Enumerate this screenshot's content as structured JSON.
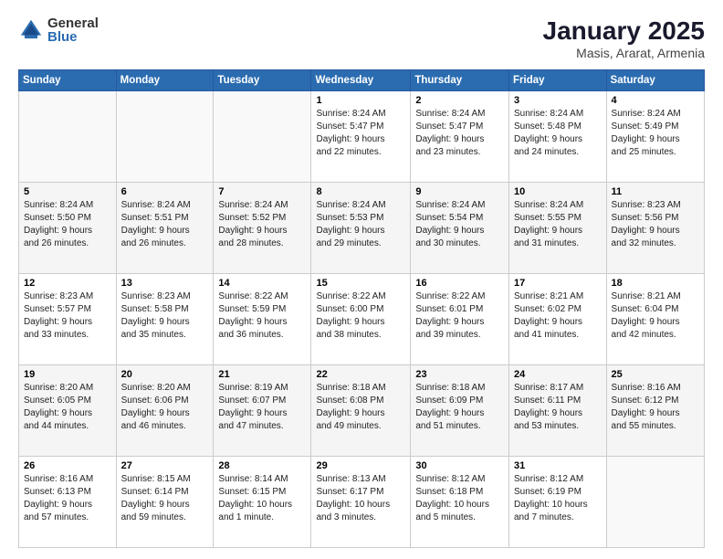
{
  "logo": {
    "general": "General",
    "blue": "Blue"
  },
  "title": "January 2025",
  "subtitle": "Masis, Ararat, Armenia",
  "weekdays": [
    "Sunday",
    "Monday",
    "Tuesday",
    "Wednesday",
    "Thursday",
    "Friday",
    "Saturday"
  ],
  "weeks": [
    [
      {
        "day": "",
        "info": ""
      },
      {
        "day": "",
        "info": ""
      },
      {
        "day": "",
        "info": ""
      },
      {
        "day": "1",
        "info": "Sunrise: 8:24 AM\nSunset: 5:47 PM\nDaylight: 9 hours\nand 22 minutes."
      },
      {
        "day": "2",
        "info": "Sunrise: 8:24 AM\nSunset: 5:47 PM\nDaylight: 9 hours\nand 23 minutes."
      },
      {
        "day": "3",
        "info": "Sunrise: 8:24 AM\nSunset: 5:48 PM\nDaylight: 9 hours\nand 24 minutes."
      },
      {
        "day": "4",
        "info": "Sunrise: 8:24 AM\nSunset: 5:49 PM\nDaylight: 9 hours\nand 25 minutes."
      }
    ],
    [
      {
        "day": "5",
        "info": "Sunrise: 8:24 AM\nSunset: 5:50 PM\nDaylight: 9 hours\nand 26 minutes."
      },
      {
        "day": "6",
        "info": "Sunrise: 8:24 AM\nSunset: 5:51 PM\nDaylight: 9 hours\nand 26 minutes."
      },
      {
        "day": "7",
        "info": "Sunrise: 8:24 AM\nSunset: 5:52 PM\nDaylight: 9 hours\nand 28 minutes."
      },
      {
        "day": "8",
        "info": "Sunrise: 8:24 AM\nSunset: 5:53 PM\nDaylight: 9 hours\nand 29 minutes."
      },
      {
        "day": "9",
        "info": "Sunrise: 8:24 AM\nSunset: 5:54 PM\nDaylight: 9 hours\nand 30 minutes."
      },
      {
        "day": "10",
        "info": "Sunrise: 8:24 AM\nSunset: 5:55 PM\nDaylight: 9 hours\nand 31 minutes."
      },
      {
        "day": "11",
        "info": "Sunrise: 8:23 AM\nSunset: 5:56 PM\nDaylight: 9 hours\nand 32 minutes."
      }
    ],
    [
      {
        "day": "12",
        "info": "Sunrise: 8:23 AM\nSunset: 5:57 PM\nDaylight: 9 hours\nand 33 minutes."
      },
      {
        "day": "13",
        "info": "Sunrise: 8:23 AM\nSunset: 5:58 PM\nDaylight: 9 hours\nand 35 minutes."
      },
      {
        "day": "14",
        "info": "Sunrise: 8:22 AM\nSunset: 5:59 PM\nDaylight: 9 hours\nand 36 minutes."
      },
      {
        "day": "15",
        "info": "Sunrise: 8:22 AM\nSunset: 6:00 PM\nDaylight: 9 hours\nand 38 minutes."
      },
      {
        "day": "16",
        "info": "Sunrise: 8:22 AM\nSunset: 6:01 PM\nDaylight: 9 hours\nand 39 minutes."
      },
      {
        "day": "17",
        "info": "Sunrise: 8:21 AM\nSunset: 6:02 PM\nDaylight: 9 hours\nand 41 minutes."
      },
      {
        "day": "18",
        "info": "Sunrise: 8:21 AM\nSunset: 6:04 PM\nDaylight: 9 hours\nand 42 minutes."
      }
    ],
    [
      {
        "day": "19",
        "info": "Sunrise: 8:20 AM\nSunset: 6:05 PM\nDaylight: 9 hours\nand 44 minutes."
      },
      {
        "day": "20",
        "info": "Sunrise: 8:20 AM\nSunset: 6:06 PM\nDaylight: 9 hours\nand 46 minutes."
      },
      {
        "day": "21",
        "info": "Sunrise: 8:19 AM\nSunset: 6:07 PM\nDaylight: 9 hours\nand 47 minutes."
      },
      {
        "day": "22",
        "info": "Sunrise: 8:18 AM\nSunset: 6:08 PM\nDaylight: 9 hours\nand 49 minutes."
      },
      {
        "day": "23",
        "info": "Sunrise: 8:18 AM\nSunset: 6:09 PM\nDaylight: 9 hours\nand 51 minutes."
      },
      {
        "day": "24",
        "info": "Sunrise: 8:17 AM\nSunset: 6:11 PM\nDaylight: 9 hours\nand 53 minutes."
      },
      {
        "day": "25",
        "info": "Sunrise: 8:16 AM\nSunset: 6:12 PM\nDaylight: 9 hours\nand 55 minutes."
      }
    ],
    [
      {
        "day": "26",
        "info": "Sunrise: 8:16 AM\nSunset: 6:13 PM\nDaylight: 9 hours\nand 57 minutes."
      },
      {
        "day": "27",
        "info": "Sunrise: 8:15 AM\nSunset: 6:14 PM\nDaylight: 9 hours\nand 59 minutes."
      },
      {
        "day": "28",
        "info": "Sunrise: 8:14 AM\nSunset: 6:15 PM\nDaylight: 10 hours\nand 1 minute."
      },
      {
        "day": "29",
        "info": "Sunrise: 8:13 AM\nSunset: 6:17 PM\nDaylight: 10 hours\nand 3 minutes."
      },
      {
        "day": "30",
        "info": "Sunrise: 8:12 AM\nSunset: 6:18 PM\nDaylight: 10 hours\nand 5 minutes."
      },
      {
        "day": "31",
        "info": "Sunrise: 8:12 AM\nSunset: 6:19 PM\nDaylight: 10 hours\nand 7 minutes."
      },
      {
        "day": "",
        "info": ""
      }
    ]
  ]
}
